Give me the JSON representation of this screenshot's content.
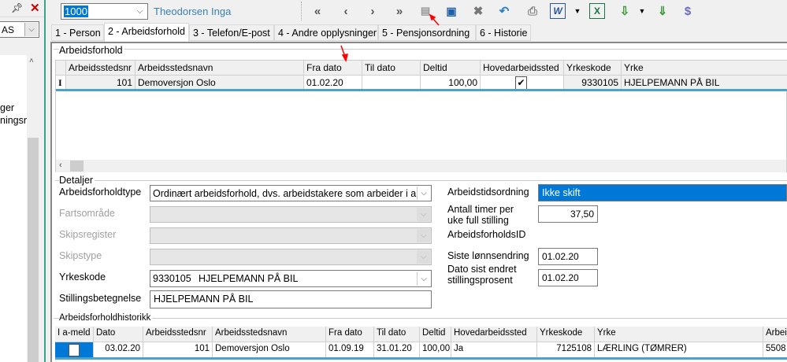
{
  "left_panel": {
    "combo_value": "AS",
    "items": [
      "ger",
      "ningsr"
    ]
  },
  "toolbar": {
    "employee_number": "1000",
    "employee_name": "Theodorsen Inga",
    "icons": [
      "first-record-icon",
      "previous-record-icon",
      "next-record-icon",
      "last-record-icon",
      "new-document-icon",
      "save-icon",
      "delete-icon",
      "undo-icon",
      "print-icon",
      "word-export-icon",
      "dropdown-icon",
      "excel-export-icon",
      "import-icon",
      "dropdown-icon",
      "download-icon",
      "dollar-icon"
    ]
  },
  "tabs": [
    "1 - Person",
    "2 - Arbeidsforhold",
    "3 - Telefon/E-post",
    "4 - Andre opplysninger",
    "5 - Pensjonsordning",
    "6 - Historie"
  ],
  "active_tab": 1,
  "arbeidsforhold": {
    "title": "Arbeidsforhold",
    "columns": [
      "Arbeidsstedsnr",
      "Arbeidsstedsnavn",
      "Fra dato",
      "Til dato",
      "Deltid",
      "Hovedarbeidssted",
      "Yrkeskode",
      "Yrke"
    ],
    "rows": [
      {
        "indicator": "I",
        "arbeidsstedsnr": "101",
        "arbeidsstedsnavn": "Demoversjon Oslo",
        "fra_dato": "01.02.20",
        "til_dato": "",
        "deltid": "100,00",
        "hovedarbeidssted": true,
        "yrkeskode": "9330105",
        "yrke": "HJELPEMANN PÅ BIL"
      }
    ]
  },
  "detaljer": {
    "title": "Detaljer",
    "arbeidsforholdtype_label": "Arbeidsforholdtype",
    "arbeidsforholdtype": "Ordinært arbeidsforhold, dvs. arbeidstakere som arbeider i ar",
    "fartsomrade_label": "Fartsområde",
    "skipsregister_label": "Skipsregister",
    "skipstype_label": "Skipstype",
    "yrkeskode_label": "Yrkeskode",
    "yrkeskode_code": "9330105",
    "yrkeskode_name": "HJELPEMANN PÅ BIL",
    "stillingsbetegnelse_label": "Stillingsbetegnelse",
    "stillingsbetegnelse": "HJELPEMANN PÅ BIL",
    "arbeidstidsordning_label": "Arbeidstidsordning",
    "arbeidstidsordning": "Ikke skift",
    "antall_timer_label_1": "Antall timer per",
    "antall_timer_label_2": "uke full stilling",
    "antall_timer": "37,50",
    "arbeidsforholdsid_label": "ArbeidsforholdsID",
    "siste_lonnsendring_label": "Siste lønnsendring",
    "siste_lonnsendring": "01.02.20",
    "dato_endret_label_1": "Dato sist endret",
    "dato_endret_label_2": "stillingsprosent",
    "dato_endret": "01.02.20"
  },
  "historikk": {
    "title": "Arbeidsforholdhistorikk",
    "columns": [
      "I a-meld",
      "Dato",
      "Arbeidsstedsnr",
      "Arbeidsstedsnavn",
      "Fra dato",
      "Til dato",
      "Deltid",
      "Hovedarbeidssted",
      "Yrkeskode",
      "Yrke",
      "Arbei"
    ],
    "rows": [
      {
        "i_a_meld": false,
        "dato": "03.02.20",
        "arbeidsstedsnr": "101",
        "arbeidsstedsnavn": "Demoversjon Oslo",
        "fra_dato": "01.09.19",
        "til_dato": "31.01.20",
        "deltid": "100,00",
        "hovedarbeidssted": "Ja",
        "yrkeskode": "7125108",
        "yrke": "LÆRLING (TØMRER)",
        "arbei": "5508"
      }
    ]
  },
  "colors": {
    "accent": "#0078d7",
    "divider": "#3aa58a",
    "row_line": "#4aa3c8",
    "annotation": "#ff0000",
    "name_text": "#3a7fb0"
  }
}
